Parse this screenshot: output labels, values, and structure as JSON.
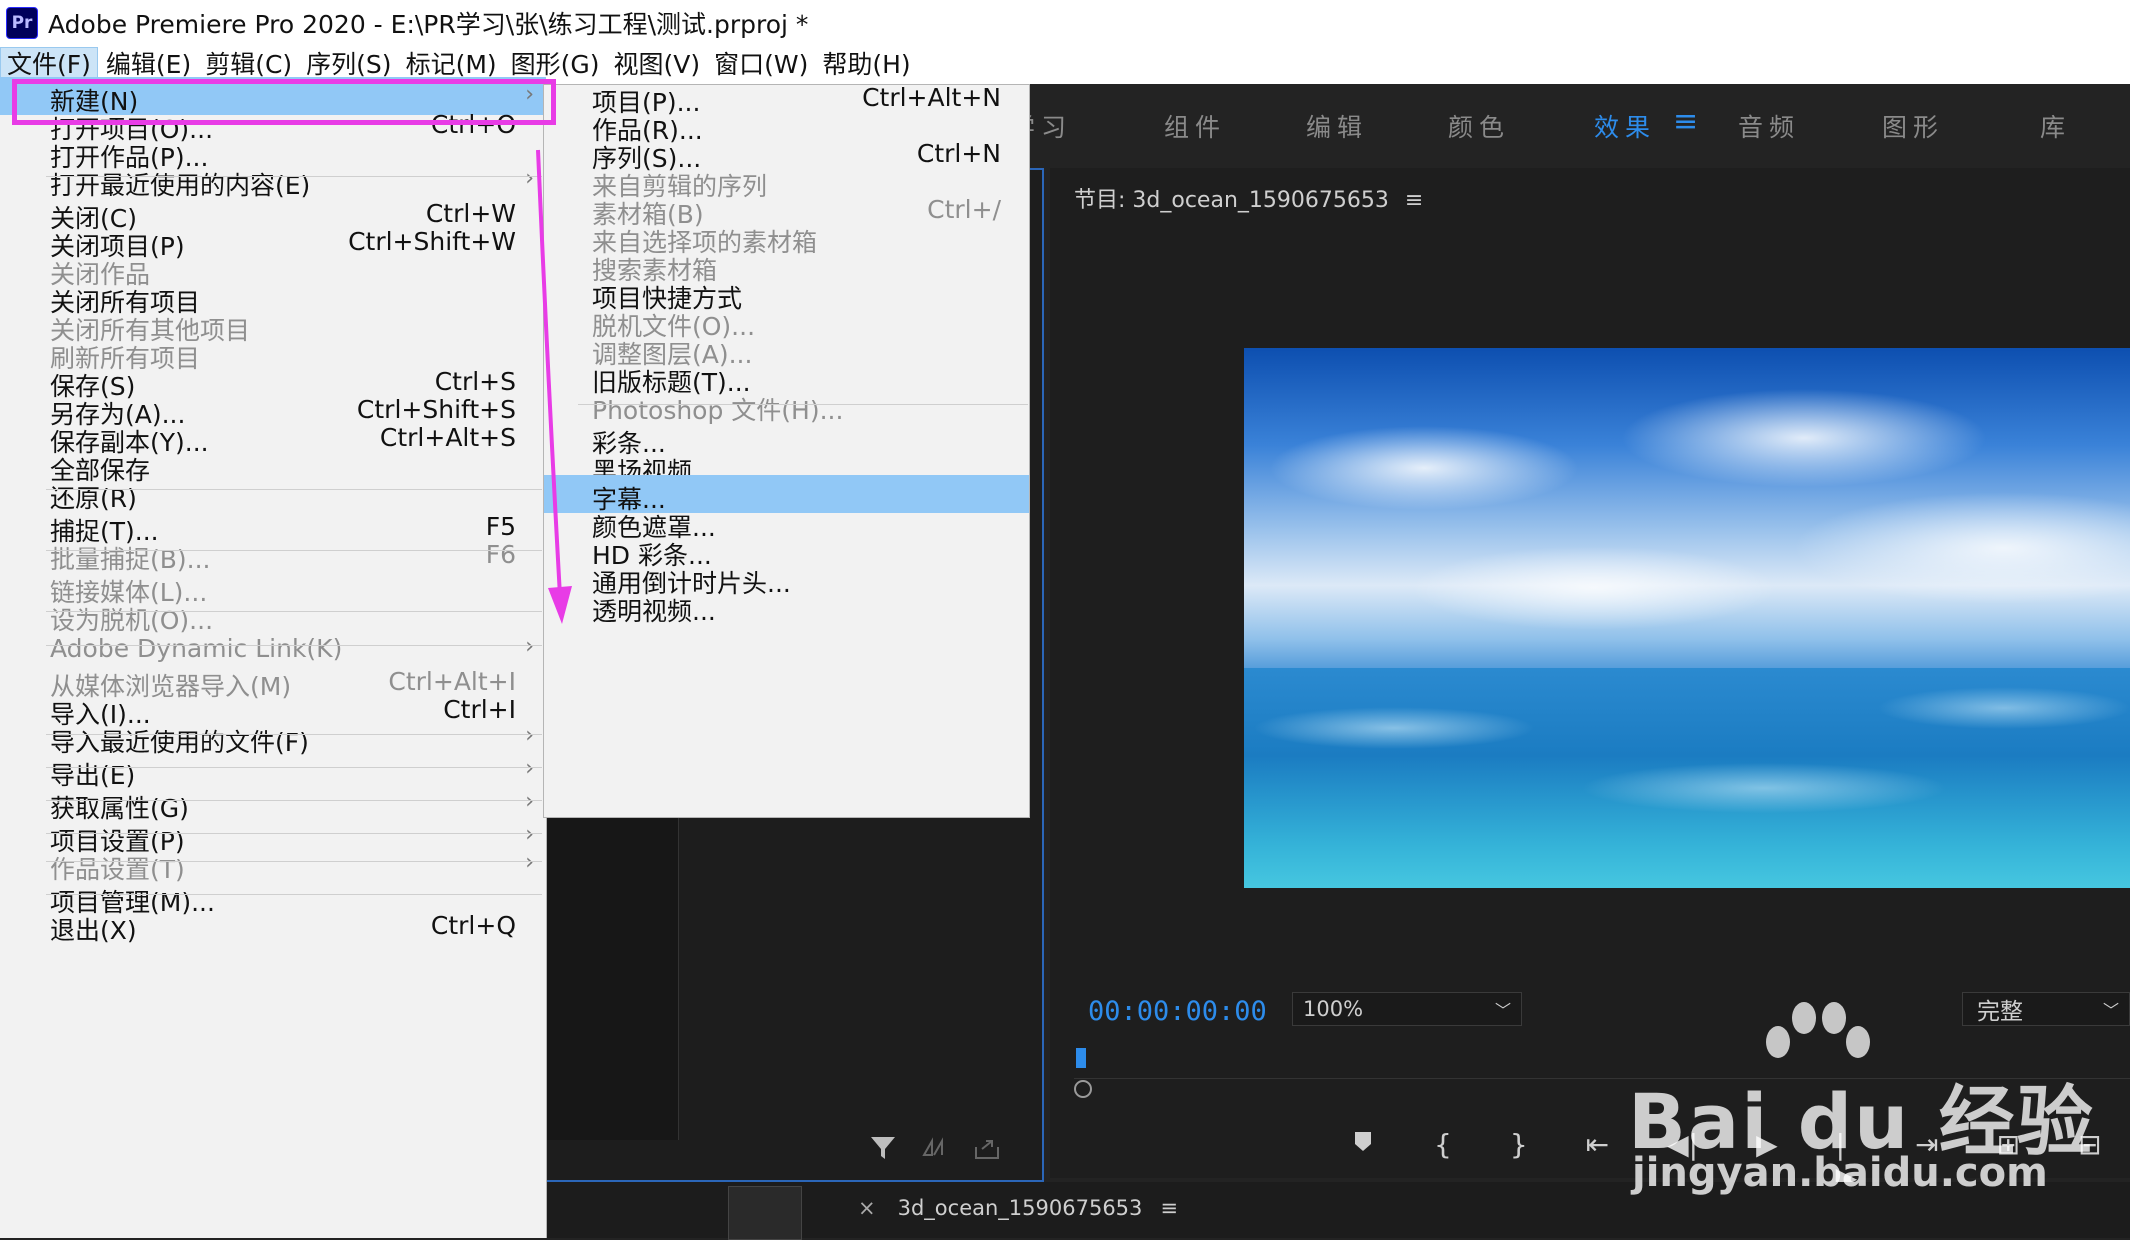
{
  "window": {
    "app_icon": "Pr",
    "title": "Adobe Premiere Pro 2020 - E:\\PR学习\\张\\练习工程\\测试.prproj *"
  },
  "menubar": [
    "文件(F)",
    "编辑(E)",
    "剪辑(C)",
    "序列(S)",
    "标记(M)",
    "图形(G)",
    "视图(V)",
    "窗口(W)",
    "帮助(H)"
  ],
  "workspace_tabs": [
    "学习",
    "组件",
    "编辑",
    "颜色",
    "效果",
    "音频",
    "图形",
    "库"
  ],
  "workspace_menu_icon": "≡",
  "file_menu": [
    {
      "label": "新建(N)",
      "shortcut": "",
      "submenu": true,
      "disabled": false
    },
    {
      "label": "打开项目(O)...",
      "shortcut": "Ctrl+O",
      "submenu": false,
      "disabled": false
    },
    {
      "label": "打开作品(P)...",
      "shortcut": "",
      "submenu": false,
      "disabled": false
    },
    {
      "label": "打开最近使用的内容(E)",
      "shortcut": "",
      "submenu": true,
      "disabled": false
    },
    {
      "label": "关闭(C)",
      "shortcut": "Ctrl+W",
      "submenu": false,
      "disabled": false
    },
    {
      "label": "关闭项目(P)",
      "shortcut": "Ctrl+Shift+W",
      "submenu": false,
      "disabled": false
    },
    {
      "label": "关闭作品",
      "shortcut": "",
      "submenu": false,
      "disabled": true
    },
    {
      "label": "关闭所有项目",
      "shortcut": "",
      "submenu": false,
      "disabled": false
    },
    {
      "label": "关闭所有其他项目",
      "shortcut": "",
      "submenu": false,
      "disabled": true
    },
    {
      "label": "刷新所有项目",
      "shortcut": "",
      "submenu": false,
      "disabled": true
    },
    {
      "label": "保存(S)",
      "shortcut": "Ctrl+S",
      "submenu": false,
      "disabled": false
    },
    {
      "label": "另存为(A)...",
      "shortcut": "Ctrl+Shift+S",
      "submenu": false,
      "disabled": false
    },
    {
      "label": "保存副本(Y)...",
      "shortcut": "Ctrl+Alt+S",
      "submenu": false,
      "disabled": false
    },
    {
      "label": "全部保存",
      "shortcut": "",
      "submenu": false,
      "disabled": false
    },
    {
      "label": "还原(R)",
      "shortcut": "",
      "submenu": false,
      "disabled": false
    },
    {
      "label": "捕捉(T)...",
      "shortcut": "F5",
      "submenu": false,
      "disabled": false
    },
    {
      "label": "批量捕捉(B)...",
      "shortcut": "F6",
      "submenu": false,
      "disabled": true
    },
    {
      "label": "链接媒体(L)...",
      "shortcut": "",
      "submenu": false,
      "disabled": true
    },
    {
      "label": "设为脱机(O)...",
      "shortcut": "",
      "submenu": false,
      "disabled": true
    },
    {
      "label": "Adobe Dynamic Link(K)",
      "shortcut": "",
      "submenu": true,
      "disabled": true
    },
    {
      "label": "从媒体浏览器导入(M)",
      "shortcut": "Ctrl+Alt+I",
      "submenu": false,
      "disabled": true
    },
    {
      "label": "导入(I)...",
      "shortcut": "Ctrl+I",
      "submenu": false,
      "disabled": false
    },
    {
      "label": "导入最近使用的文件(F)",
      "shortcut": "",
      "submenu": true,
      "disabled": false
    },
    {
      "label": "导出(E)",
      "shortcut": "",
      "submenu": true,
      "disabled": false
    },
    {
      "label": "获取属性(G)",
      "shortcut": "",
      "submenu": true,
      "disabled": false
    },
    {
      "label": "项目设置(P)",
      "shortcut": "",
      "submenu": true,
      "disabled": false
    },
    {
      "label": "作品设置(T)",
      "shortcut": "",
      "submenu": true,
      "disabled": true
    },
    {
      "label": "项目管理(M)...",
      "shortcut": "",
      "submenu": false,
      "disabled": false
    },
    {
      "label": "退出(X)",
      "shortcut": "Ctrl+Q",
      "submenu": false,
      "disabled": false
    }
  ],
  "new_submenu": [
    {
      "label": "项目(P)...",
      "shortcut": "Ctrl+Alt+N",
      "disabled": false
    },
    {
      "label": "作品(R)...",
      "shortcut": "",
      "disabled": false
    },
    {
      "label": "序列(S)...",
      "shortcut": "Ctrl+N",
      "disabled": false
    },
    {
      "label": "来自剪辑的序列",
      "shortcut": "",
      "disabled": true
    },
    {
      "label": "素材箱(B)",
      "shortcut": "Ctrl+/",
      "disabled": true
    },
    {
      "label": "来自选择项的素材箱",
      "shortcut": "",
      "disabled": true
    },
    {
      "label": "搜索素材箱",
      "shortcut": "",
      "disabled": true
    },
    {
      "label": "项目快捷方式",
      "shortcut": "",
      "disabled": false
    },
    {
      "label": "脱机文件(O)...",
      "shortcut": "",
      "disabled": true
    },
    {
      "label": "调整图层(A)...",
      "shortcut": "",
      "disabled": true
    },
    {
      "label": "旧版标题(T)...",
      "shortcut": "",
      "disabled": false
    },
    {
      "label": "Photoshop 文件(H)...",
      "shortcut": "",
      "disabled": true
    },
    {
      "label": "彩条...",
      "shortcut": "",
      "disabled": false
    },
    {
      "label": "黑场视频...",
      "shortcut": "",
      "disabled": false
    },
    {
      "label": "字幕...",
      "shortcut": "",
      "disabled": false
    },
    {
      "label": "颜色遮罩...",
      "shortcut": "",
      "disabled": false
    },
    {
      "label": "HD 彩条...",
      "shortcut": "",
      "disabled": false
    },
    {
      "label": "通用倒计时片头...",
      "shortcut": "",
      "disabled": false
    },
    {
      "label": "透明视频...",
      "shortcut": "",
      "disabled": false
    }
  ],
  "program_monitor": {
    "title": "节目: 3d_ocean_1590675653",
    "menu_icon": "≡",
    "timecode": "00:00:00:00",
    "zoom": "100%",
    "quality": "完整"
  },
  "sequence_tab": {
    "close": "×",
    "name": "3d_ocean_1590675653",
    "menu_icon": "≡"
  },
  "watermark": {
    "brand": "Bai du 经验",
    "url": "jingyan.baidu.com"
  },
  "colors": {
    "accent_blue": "#2d8ceb",
    "menu_highlight": "#91c8f6",
    "annotation_magenta": "#e83ce6"
  }
}
